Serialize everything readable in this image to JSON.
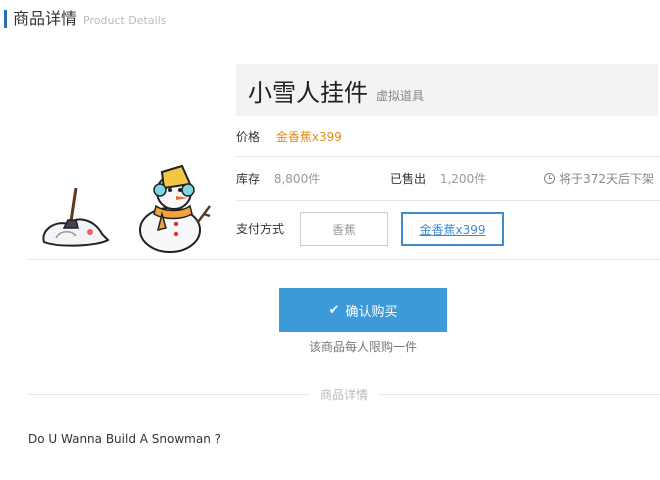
{
  "header": {
    "title": "商品详情",
    "subtitle": "Product Details"
  },
  "product": {
    "name": "小雪人挂件",
    "tag": "虚拟道具",
    "price_label": "价格",
    "price_value": "金香蕉x399",
    "stock_label": "库存",
    "stock_value": "8,800件",
    "sold_label": "已售出",
    "sold_value": "1,200件",
    "expire_text": "将于372天后下架",
    "pay_label": "支付方式",
    "pay_options": [
      "香蕉",
      "金香蕉x399"
    ]
  },
  "actions": {
    "buy_label": "确认购买",
    "limit_note": "该商品每人限购一件"
  },
  "details": {
    "section_title": "商品详情",
    "description": "Do U Wanna Build A Snowman ?"
  },
  "colors": {
    "accent": "#3d9ad9",
    "price": "#e08a16",
    "header_bar": "#2a6cb0"
  }
}
